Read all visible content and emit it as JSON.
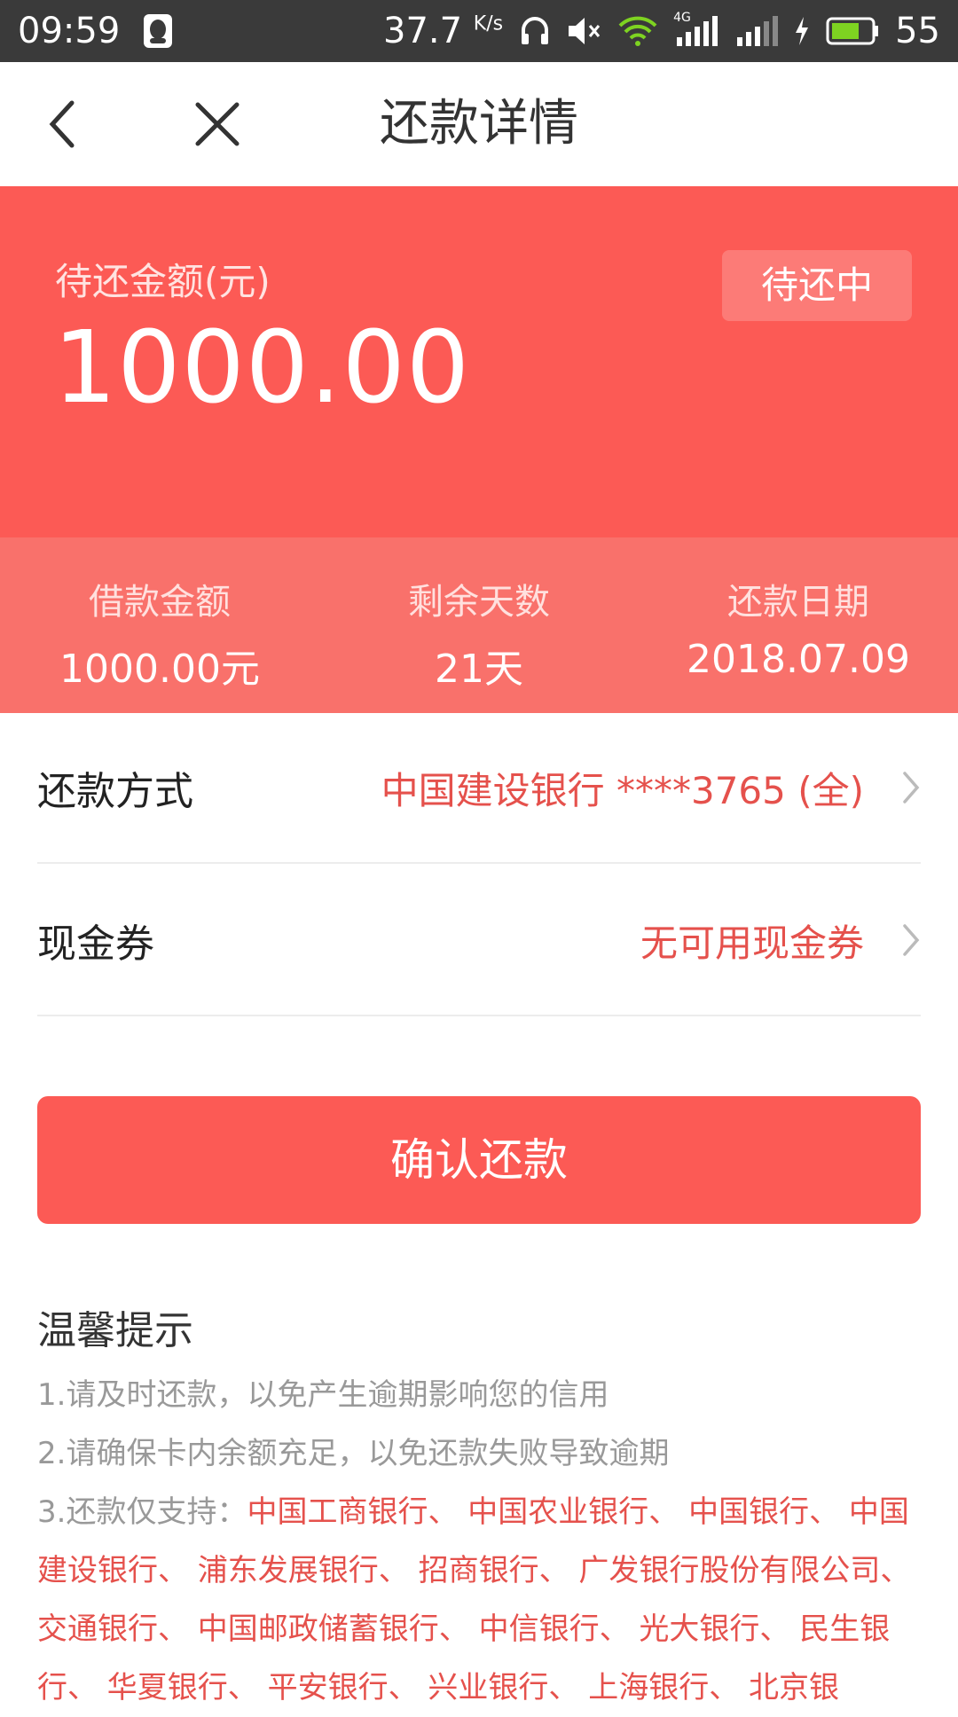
{
  "status_bar": {
    "time": "09:59",
    "speed_value": "37.7",
    "speed_unit": "K/s",
    "signal_label": "4G",
    "battery": "55"
  },
  "nav": {
    "title": "还款详情"
  },
  "hero": {
    "label": "待还金额(元)",
    "amount": "1000.00",
    "status_badge": "待还中"
  },
  "stats": [
    {
      "label": "借款金额",
      "value": "1000.00元"
    },
    {
      "label": "剩余天数",
      "value": "21天"
    },
    {
      "label": "还款日期",
      "value": "2018.07.09"
    }
  ],
  "payment_method": {
    "label": "还款方式",
    "value": "中国建设银行 ****3765 (全)"
  },
  "coupon": {
    "label": "现金券",
    "value": "无可用现金券"
  },
  "confirm_button": "确认还款",
  "tips": {
    "title": "温馨提示",
    "line1": "1.请及时还款，以免产生逾期影响您的信用",
    "line2": "2.请确保卡内余额充足，以免还款失败导致逾期",
    "line3_prefix": "3.还款仅支持：",
    "line3_banks": "中国工商银行、 中国农业银行、 中国银行、 中国建设银行、 浦东发展银行、 招商银行、 广发银行股份有限公司、 交通银行、 中国邮政储蓄银行、 中信银行、 光大银行、 民生银行、 华夏银行、 平安银行、 兴业银行、 上海银行、 北京银"
  },
  "colors": {
    "accent": "#fc5a55",
    "accent_light": "#f9716b",
    "value_red": "#e5514c",
    "status_bar": "#3a3a3a"
  }
}
